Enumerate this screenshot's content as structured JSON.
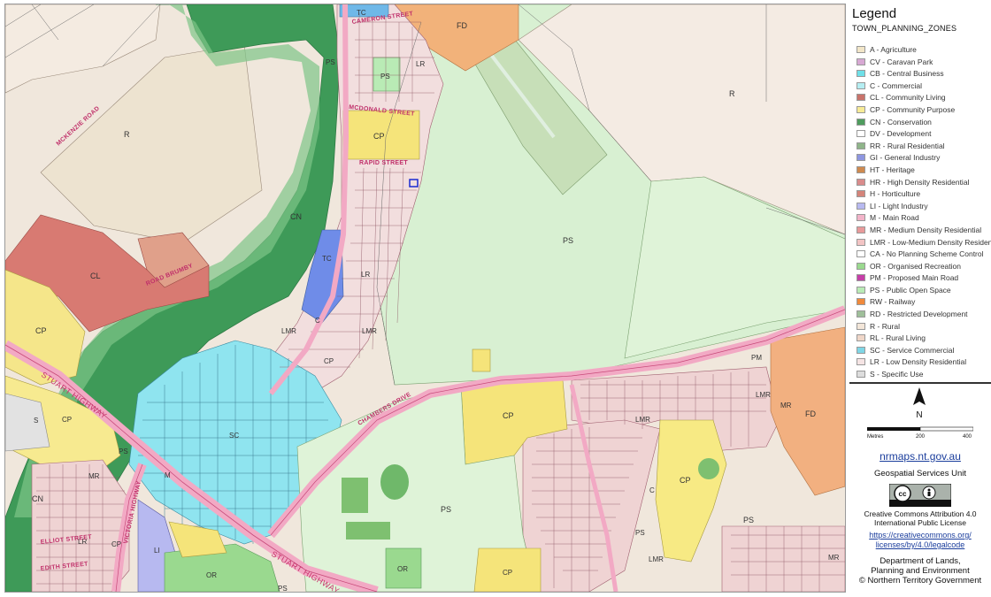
{
  "legend": {
    "title": "Legend",
    "subtitle": "TOWN_PLANNING_ZONES",
    "items": [
      {
        "label": "A - Agriculture",
        "color": "#f2e6c8"
      },
      {
        "label": "CV - Caravan Park",
        "color": "#d7a8d3"
      },
      {
        "label": "CB - Central Business",
        "color": "#6fe0e8"
      },
      {
        "label": "C - Commercial",
        "color": "#b5eef2"
      },
      {
        "label": "CL - Community Living",
        "color": "#c9736b"
      },
      {
        "label": "CP - Community Purpose",
        "color": "#f7eb96"
      },
      {
        "label": "CN - Conservation",
        "color": "#4f9c5e"
      },
      {
        "label": "DV - Development",
        "color": "#ffffff"
      },
      {
        "label": "RR - Rural Residential",
        "color": "#8fb58a"
      },
      {
        "label": "GI - General Industry",
        "color": "#8e96e0"
      },
      {
        "label": "HT - Heritage",
        "color": "#cf8a4f"
      },
      {
        "label": "HR - High Density Residential",
        "color": "#d98c8c"
      },
      {
        "label": "H - Horticulture",
        "color": "#d4847a"
      },
      {
        "label": "LI - Light Industry",
        "color": "#b7b9f0"
      },
      {
        "label": "M - Main Road",
        "color": "#f2b3c9"
      },
      {
        "label": "MR - Medium Density Residential",
        "color": "#e89a9a"
      },
      {
        "label": "LMR - Low-Medium Density Residential",
        "color": "#f2c4c4"
      },
      {
        "label": "CA - No Planning Scheme Control",
        "color": "#ffffff"
      },
      {
        "label": "OR - Organised Recreation",
        "color": "#9ad98f"
      },
      {
        "label": "PM - Proposed Main Road",
        "color": "#c63fa8"
      },
      {
        "label": "PS - Public Open Space",
        "color": "#b9ebb5"
      },
      {
        "label": "RW - Railway",
        "color": "#f08a3c"
      },
      {
        "label": "RD - Restricted Development",
        "color": "#9fbf9a"
      },
      {
        "label": "R - Rural",
        "color": "#f3e6d9"
      },
      {
        "label": "RL - Rural Living",
        "color": "#efd6c8"
      },
      {
        "label": "SC - Service Commercial",
        "color": "#7fd6e6"
      },
      {
        "label": "LR - Low Density Residential",
        "color": "#f5e4e4"
      },
      {
        "label": "S - Specific Use",
        "color": "#dddddd"
      }
    ],
    "north_label": "N",
    "scale_labels": [
      "Metres",
      "200",
      "400"
    ],
    "url": "nrmaps.nt.gov.au",
    "unit": "Geospatial Services Unit",
    "license_lines": [
      "Creative Commons Attribution 4.0",
      "International Public License"
    ],
    "license_link_lines": [
      "https://creativecommons.org/",
      "licenses/by/4.0/legalcode"
    ],
    "department_lines": [
      "Department of Lands,",
      "Planning and Environment"
    ],
    "copyright": "© Northern Territory Government",
    "cc_text": "cc"
  },
  "map": {
    "zone_labels": {
      "fd_top": "FD",
      "r_top": "R",
      "tc_top": "TC",
      "ps_a": "PS",
      "ps_b": "PS",
      "lr_a": "LR",
      "r_left": "R",
      "cp_a": "CP",
      "cn_main": "CN",
      "cl": "CL",
      "tc_mid": "TC",
      "lr_mid": "LR",
      "ps_big": "PS",
      "c_mid": "C",
      "lmr_a": "LMR",
      "lmr_b": "LMR",
      "cp_left": "CP",
      "cp_mid_small": "CP",
      "pm": "PM",
      "lmr_c": "LMR",
      "lmr_d": "LMR",
      "mr_right": "MR",
      "fd_right": "FD",
      "cp_left2": "CP",
      "s_left": "S",
      "cp_center": "CP",
      "sc": "SC",
      "ps_c": "PS",
      "mr_left": "MR",
      "cn_left": "CN",
      "ps_bottom": "PS",
      "cp_bottom_left": "CP",
      "li": "LI",
      "or_a": "OR",
      "or_b": "OR",
      "cp_bottom": "CP",
      "cp_right": "CP",
      "ps_right": "PS",
      "c_right": "C",
      "lmr_e": "LMR",
      "ps_d": "PS",
      "mr_bottom": "MR",
      "lr_bottom": "LR",
      "m_mid": "M",
      "ps_e": "PS"
    },
    "street_labels": {
      "cameron": "CAMERON STREET",
      "mcdonald": "MCDONALD STREET",
      "rapid": "RAPID STREET",
      "mckenzie": "MCKENZIE ROAD",
      "brumby": "ROAD BRUMBY",
      "stuart": "STUART HIGHWAY",
      "stuart2": "STUART HIGHWAY",
      "chambers": "CHAMBERS DRIVE",
      "victoria": "VICTORIA HIGHWAY",
      "elliot": "ELLIOT STREET",
      "edith": "EDITH STREET"
    }
  }
}
